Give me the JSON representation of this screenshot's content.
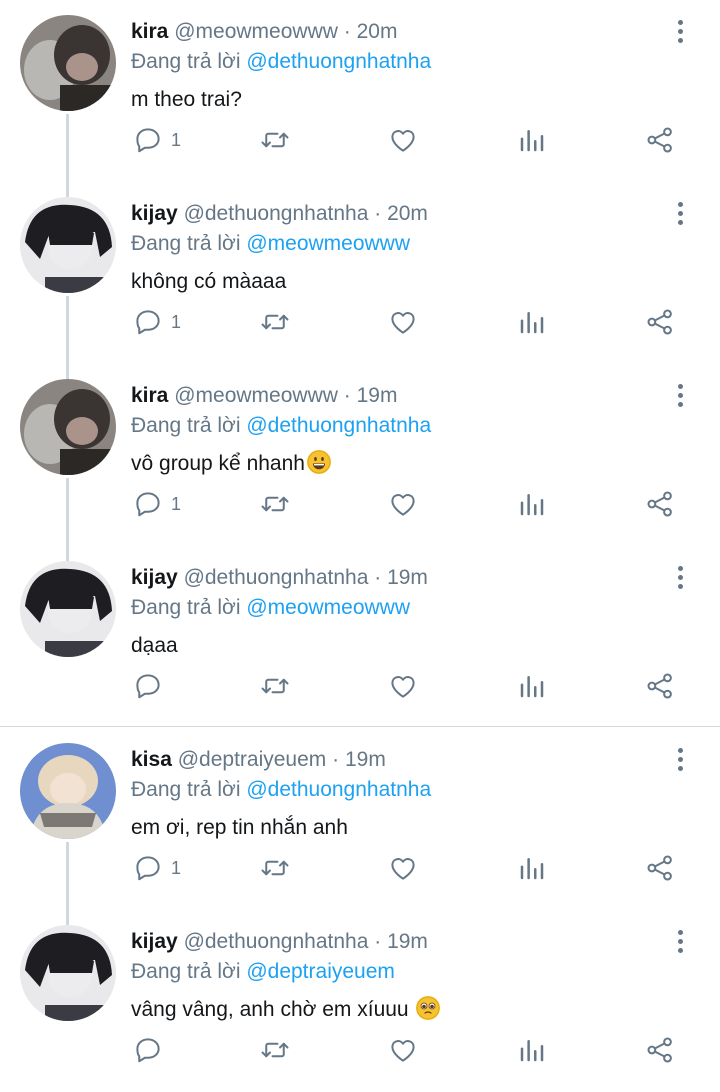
{
  "tweets": [
    {
      "name": "kira",
      "handle": "@meowmeowww",
      "dot": "·",
      "time": "20m",
      "reply_prefix": "Đang trả lời",
      "reply_to": "@dethuongnhatnha",
      "text": "m theo trai?",
      "emoji": "",
      "replies": "1",
      "avatar": "cat-boy"
    },
    {
      "name": "kijay",
      "handle": "@dethuongnhatnha",
      "dot": "·",
      "time": "20m",
      "reply_prefix": "Đang trả lời",
      "reply_to": "@meowmeowww",
      "text": "không có màaaa",
      "emoji": "",
      "replies": "1",
      "avatar": "dark-hair"
    },
    {
      "name": "kira",
      "handle": "@meowmeowww",
      "dot": "·",
      "time": "19m",
      "reply_prefix": "Đang trả lời",
      "reply_to": "@dethuongnhatnha",
      "text": "vô group kể nhanh",
      "emoji": "grinning",
      "replies": "1",
      "avatar": "cat-boy"
    },
    {
      "name": "kijay",
      "handle": "@dethuongnhatnha",
      "dot": "·",
      "time": "19m",
      "reply_prefix": "Đang trả lời",
      "reply_to": "@meowmeowww",
      "text": "dạaa",
      "emoji": "",
      "replies": "",
      "avatar": "dark-hair"
    },
    {
      "name": "kisa",
      "handle": "@deptraiyeuem",
      "dot": "·",
      "time": "19m",
      "reply_prefix": "Đang trả lời",
      "reply_to": "@dethuongnhatnha",
      "text": "em ơi, rep tin nhắn anh",
      "emoji": "",
      "replies": "1",
      "avatar": "blonde"
    },
    {
      "name": "kijay",
      "handle": "@dethuongnhatnha",
      "dot": "·",
      "time": "19m",
      "reply_prefix": "Đang trả lời",
      "reply_to": "@deptraiyeuem",
      "text": "vâng vâng, anh chờ em xíuuu ",
      "emoji": "pleading",
      "replies": "",
      "avatar": "dark-hair"
    }
  ],
  "icons": {
    "reply": "reply-icon",
    "retweet": "retweet-icon",
    "like": "heart-icon",
    "analytics": "analytics-icon",
    "share": "share-icon",
    "more": "more-vertical-icon"
  },
  "colors": {
    "name": "#14171a",
    "secondary": "#657786",
    "mention": "#1da1f2",
    "thread_line": "#cfd9de",
    "divider": "#d6d9db"
  }
}
